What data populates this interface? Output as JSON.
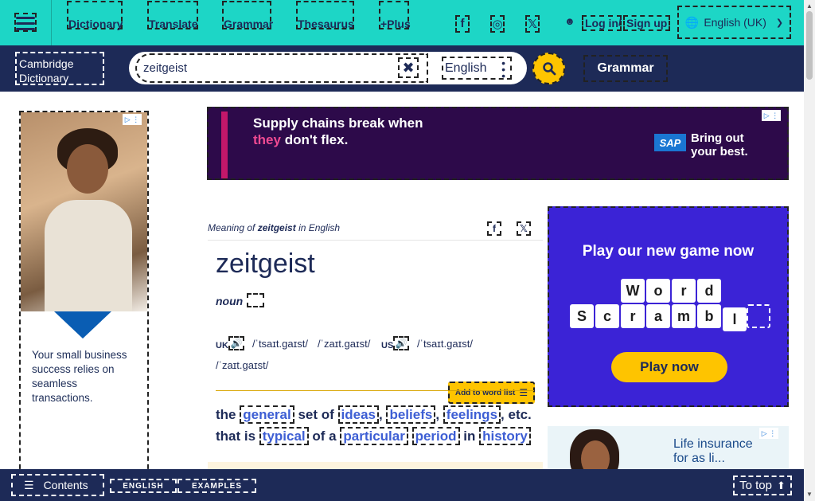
{
  "topbar": {
    "nav": [
      "Dictionary",
      "Translate",
      "Grammar",
      "Thesaurus",
      "+Plus"
    ],
    "social": {
      "facebook": "f",
      "instagram": "◎",
      "x": "𝕏"
    },
    "login": "Log in",
    "separator": "/",
    "signup": "Sign up",
    "language": "English (UK)"
  },
  "navbar": {
    "logo_alt": "Cambridge Dictionary",
    "search_value": "zeitgeist",
    "dictionary_select": "English",
    "grammar_label": "Grammar"
  },
  "ad_top": {
    "headline_1": "Supply chains break when",
    "headline_2_pink": "they",
    "headline_2_white": "don't flex.",
    "brand": "SAP",
    "tagline_1": "Bring out",
    "tagline_2": "your best."
  },
  "ad_left": {
    "text": "Your small business success relies on seamless transactions."
  },
  "entry": {
    "meaning_prefix": "Meaning of ",
    "meaning_word": "zeitgeist",
    "meaning_suffix": " in English",
    "headword": "zeitgeist",
    "pos": "noun",
    "uk_label": "UK",
    "uk_ipa_1": "/ˈtsaɪt.ɡaɪst/",
    "uk_ipa_2": "/ˈzaɪt.ɡaɪst/",
    "us_label": "US",
    "us_ipa_1": "/ˈtsaɪt.ɡaɪst/",
    "us_ipa_2": "/ˈzaɪt.ɡaɪst/",
    "add_to_list": "Add to word list",
    "definition": {
      "w1": "the",
      "l1": "general",
      "w2": "set of",
      "l2": "ideas",
      "l3": "beliefs",
      "l4": "feelings",
      "w3": "etc.",
      "w4": "that is",
      "l5": "typical",
      "w5": "of a",
      "l6": "particular",
      "l7": "period",
      "w6": "in",
      "l8": "history"
    }
  },
  "ad_right": {
    "title": "Play our new game now",
    "row1": [
      "W",
      "o",
      "r",
      "d"
    ],
    "row2": [
      "S",
      "c",
      "r",
      "a",
      "m",
      "b",
      "l",
      ""
    ],
    "button": "Play now"
  },
  "ad_right2": {
    "text_1": "Life insurance",
    "text_2": "for as li..."
  },
  "bottombar": {
    "contents": "Contents",
    "tab_english": "ENGLISH",
    "tab_examples": "EXAMPLES",
    "to_top": "To top"
  },
  "colors": {
    "topbar": "#1dd6c6",
    "navy": "#1d2a57",
    "accent_yellow": "#fec400",
    "link_blue": "#3d5ed4"
  }
}
